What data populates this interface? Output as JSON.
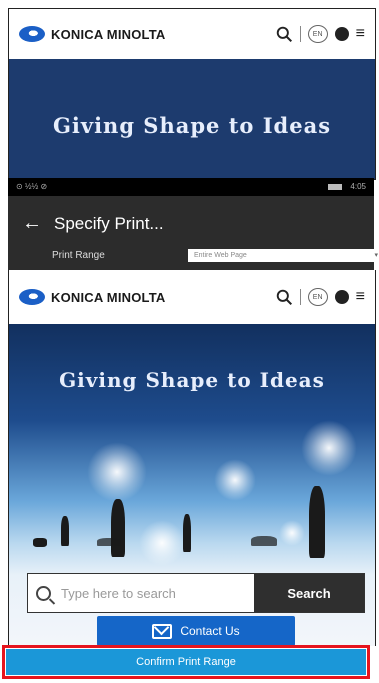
{
  "top_preview": {
    "logo_text": "KONICA MINOLTA",
    "lang_badge": "EN",
    "tagline": "Giving Shape to Ideas"
  },
  "status_bar": {
    "left": "⊙ ½½ ⊘",
    "time": "4:05"
  },
  "dialog": {
    "title": "Specify Print...",
    "print_range_label": "Print Range",
    "print_range_value": "Entire Web Page"
  },
  "preview": {
    "logo_text": "KONICA MINOLTA",
    "lang_badge": "EN",
    "tagline": "Giving Shape to Ideas",
    "search_placeholder": "Type here to search",
    "search_button": "Search",
    "contact_button": "Contact Us"
  },
  "confirm_button": "Confirm Print Range",
  "colors": {
    "brand_blue": "#1b5fc6",
    "confirm_blue": "#1b97d8",
    "highlight_red": "#e6151e"
  },
  "icons": [
    "search-icon",
    "language-icon",
    "globe-icon",
    "menu-icon",
    "back-arrow-icon",
    "envelope-icon",
    "pointer-cursor-icon"
  ]
}
